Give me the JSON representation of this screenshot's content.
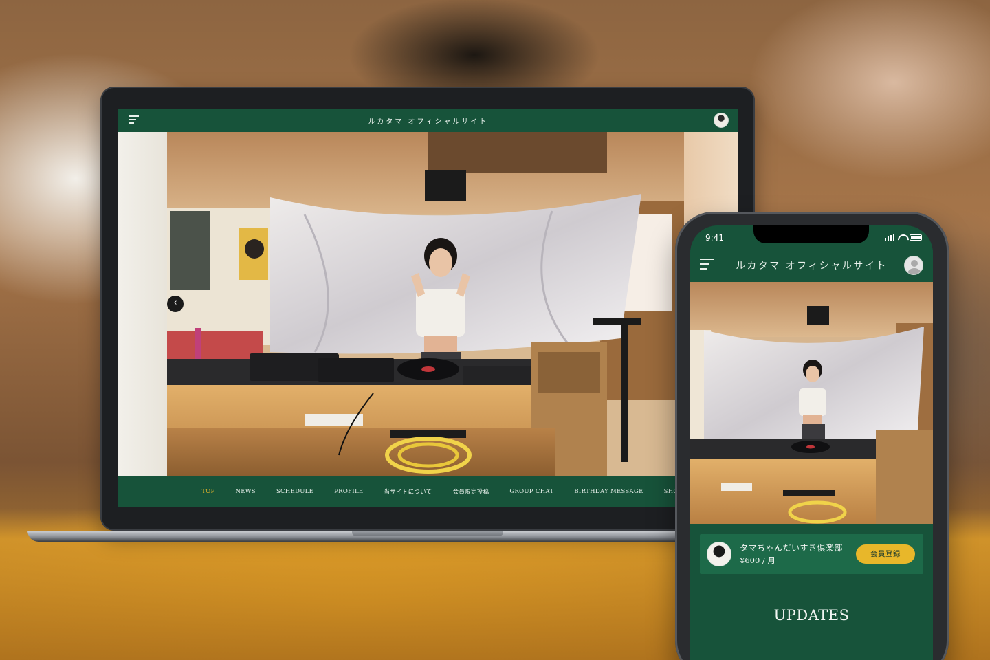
{
  "laptop": {
    "site_title": "ルカタマ オフィシャルサイト",
    "prev_glyph": "‹",
    "nav": [
      {
        "label": "TOP",
        "active": true
      },
      {
        "label": "NEWS",
        "active": false
      },
      {
        "label": "SCHEDULE",
        "active": false
      },
      {
        "label": "PROFILE",
        "active": false
      },
      {
        "label": "当サイトについて",
        "active": false
      },
      {
        "label": "会員限定投稿",
        "active": false
      },
      {
        "label": "GROUP CHAT",
        "active": false
      },
      {
        "label": "BIRTHDAY MESSAGE",
        "active": false
      },
      {
        "label": "SHOP",
        "active": false
      }
    ]
  },
  "phone": {
    "status_time": "9:41",
    "site_title": "ルカタマ オフィシャルサイト",
    "membership": {
      "name": "タマちゃんだいすき倶楽部",
      "price": "¥600 / 月",
      "join_label": "会員登録"
    },
    "section_title": "UPDATES"
  },
  "colors": {
    "brand_green": "#17533a",
    "card_green": "#1d6a49",
    "accent_gold": "#e8b72a"
  },
  "icons": [
    "menu-icon",
    "avatar-icon",
    "chevron-left-icon",
    "signal-icon",
    "wifi-icon",
    "battery-icon"
  ]
}
